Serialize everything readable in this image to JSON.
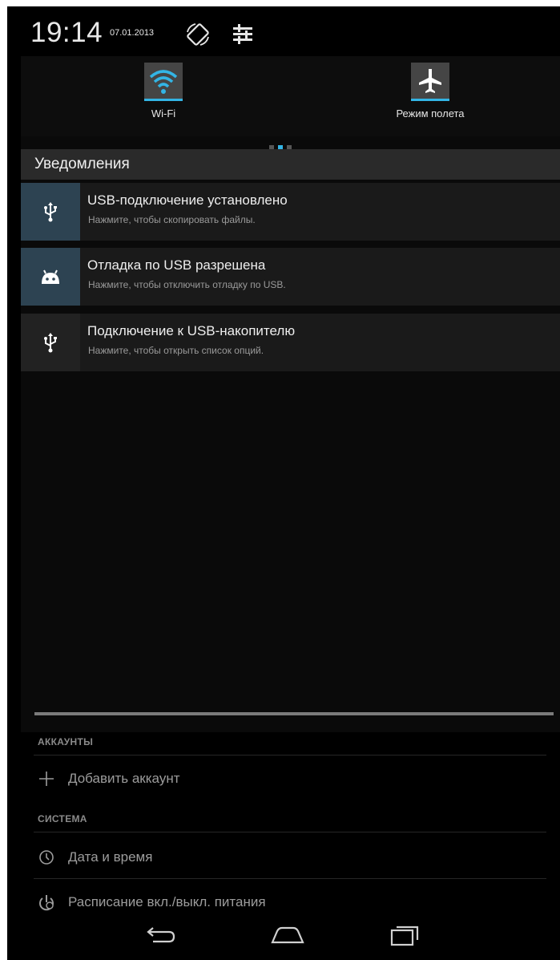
{
  "status": {
    "time": "19:14",
    "date": "07.01.2013",
    "icons": [
      "rotate-icon",
      "settings-sliders-icon"
    ]
  },
  "quick_settings": {
    "tiles": [
      {
        "label": "Wi-Fi",
        "icon": "wifi-icon",
        "active": true
      },
      {
        "label": "Режим полета",
        "icon": "airplane-icon",
        "active": true
      }
    ],
    "page_count": 3,
    "current_page": 2
  },
  "notifications": {
    "header": "Уведомления",
    "items": [
      {
        "title": "USB-подключение установлено",
        "text": "Нажмите, чтобы скопировать файлы.",
        "icon": "usb-icon"
      },
      {
        "title": "Отладка по USB разрешена",
        "text": "Нажмите, чтобы отключить отладку по USB.",
        "icon": "android-icon"
      },
      {
        "title": "Подключение к USB-накопителю",
        "text": "Нажмите, чтобы открыть список опций.",
        "icon": "usb-icon"
      }
    ]
  },
  "settings": {
    "accounts_header": "АККАУНТЫ",
    "add_account": "Добавить аккаунт",
    "system_header": "СИСТЕМА",
    "date_time": "Дата и время",
    "power_schedule": "Расписание вкл./выкл. питания"
  },
  "navbar": [
    "back-icon",
    "home-icon",
    "recents-icon"
  ],
  "colors": {
    "accent": "#33b5e5",
    "shade_bg": "#0a0a0a",
    "notif_bg": "#1a1a1a",
    "header_bg": "#2a2a2a"
  }
}
